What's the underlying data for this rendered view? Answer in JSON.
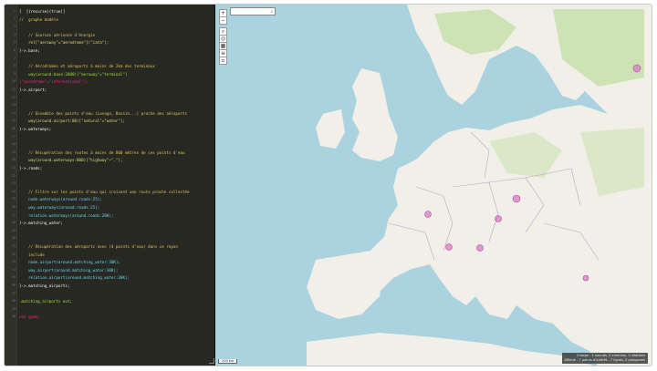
{
  "editor": {
    "lines": [
      {
        "n": "1",
        "text": "[  ](recurse)(true)]",
        "cls": ""
      },
      {
        "n": "2",
        "text": "//  graphe modèle",
        "cls": "comment"
      },
      {
        "n": "3",
        "text": "",
        "cls": ""
      },
      {
        "n": "4",
        "text": "    // Sources aérienne d'énergie",
        "cls": "comment"
      },
      {
        "n": "5",
        "text": "    rel[\"aeroway\"=\"aerodrome\"](\"iata\");",
        "cls": "str"
      },
      {
        "n": "6",
        "text": "}->.base;",
        "cls": ""
      },
      {
        "n": "7",
        "text": "",
        "cls": ""
      },
      {
        "n": "8",
        "text": "    // Aérodromes et aéroports à moins de 2km des terminaux",
        "cls": "comment"
      },
      {
        "n": "9",
        "text": "    way(around.base:2000)[\"aeroway\"=\"terminal\"]",
        "cls": "var"
      },
      {
        "n": "10",
        "text": "[\"aerodrome\"=\"international\"];",
        "cls": "kw"
      },
      {
        "n": "11",
        "text": "}->.airport;",
        "cls": ""
      },
      {
        "n": "12",
        "text": "",
        "cls": ""
      },
      {
        "n": "13",
        "text": "",
        "cls": ""
      },
      {
        "n": "14",
        "text": "    // Ensemble des points d'eau (Lavage, Bassin...) proche des aéroports",
        "cls": "comment"
      },
      {
        "n": "15",
        "text": "    way(around.airport:80)[\"natural\"=\"water\"];",
        "cls": "str"
      },
      {
        "n": "16",
        "text": "}->.waterways;",
        "cls": ""
      },
      {
        "n": "17",
        "text": "",
        "cls": ""
      },
      {
        "n": "18",
        "text": "",
        "cls": ""
      },
      {
        "n": "19",
        "text": "    // Récupération des routes à moins de 800 mètres de ces points d'eau",
        "cls": "comment"
      },
      {
        "n": "20",
        "text": "    way(around.waterways:800)[\"highway\"~\".\"];",
        "cls": "str"
      },
      {
        "n": "21",
        "text": "}->.roads;",
        "cls": ""
      },
      {
        "n": "22",
        "text": "",
        "cls": ""
      },
      {
        "n": "23",
        "text": "",
        "cls": ""
      },
      {
        "n": "24",
        "text": "    // Filtre sur les points d'eau qui croisent une route proche collectée",
        "cls": "comment"
      },
      {
        "n": "25",
        "text": "    node.waterways(around.roads:25);",
        "cls": "fn"
      },
      {
        "n": "26",
        "text": "    way.waterways(around.roads:25);",
        "cls": "fn"
      },
      {
        "n": "27",
        "text": "    relation.waterways(around.roads:200);",
        "cls": "fn"
      },
      {
        "n": "28",
        "text": "}->.matching_water;",
        "cls": ""
      },
      {
        "n": "29",
        "text": "",
        "cls": ""
      },
      {
        "n": "30",
        "text": "",
        "cls": ""
      },
      {
        "n": "31",
        "text": "    // Récupération des aéroports avec (4 points d'eau) dans ce rayon",
        "cls": "comment"
      },
      {
        "n": "32",
        "text": "    include",
        "cls": "comment"
      },
      {
        "n": "33",
        "text": "    node.airport(around.matching_water:30K);",
        "cls": "fn"
      },
      {
        "n": "34",
        "text": "    way.airport(around.matching_water:30K);",
        "cls": "fn"
      },
      {
        "n": "35",
        "text": "    relation.airport(around.matching_water:30K);",
        "cls": "fn"
      },
      {
        "n": "36",
        "text": "}->.matching_airports;",
        "cls": ""
      },
      {
        "n": "37",
        "text": "",
        "cls": ""
      },
      {
        "n": "38",
        "text": ".matching_airports out;",
        "cls": "var"
      },
      {
        "n": "39",
        "text": "",
        "cls": ""
      },
      {
        "n": "40",
        "text": "out geom;",
        "cls": "kw"
      }
    ]
  },
  "map": {
    "search_value": "",
    "zoom_in": "+",
    "zoom_out": "−",
    "scale_label": "200 km",
    "status_line1": "Charge : 1 noeuds, 0 chemins, 1 relations",
    "status_line2": "Affiché : 7 points d'intérêt - 7 lignes, 0 polygones",
    "colors": {
      "water": "#aad3df",
      "land": "#f2efe9",
      "forest": "#c8dfb0",
      "marker": "#d77ac6"
    }
  }
}
